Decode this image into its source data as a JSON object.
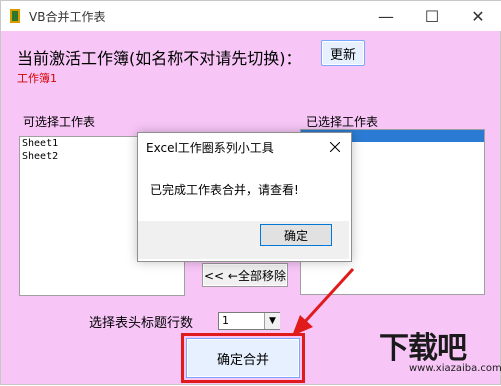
{
  "window": {
    "title": "VB合并工作表",
    "min_symbol": "—",
    "max_symbol": "☐",
    "close_symbol": "✕"
  },
  "main": {
    "current_label": "当前激活工作簿(如名称不对请先切换)：",
    "update_label": "更新",
    "workbook_name": "工作簿1",
    "available_label": "可选择工作表",
    "selected_label": "已选择工作表",
    "available_items": [
      "Sheet1",
      "Sheet2"
    ],
    "remove_all_label": "<< ←全部移除",
    "header_rows_label": "选择表头标题行数",
    "header_rows_value": "1",
    "merge_label": "确定合并"
  },
  "dialog": {
    "title": "Excel工作圈系列小工具",
    "message": "已完成工作表合并，请查看!",
    "ok_label": "确定"
  },
  "watermark": {
    "text": "下载吧",
    "site": "www.xiazaiba.com"
  },
  "colors": {
    "background": "#f7c6f7",
    "accent": "#e01b1b"
  }
}
